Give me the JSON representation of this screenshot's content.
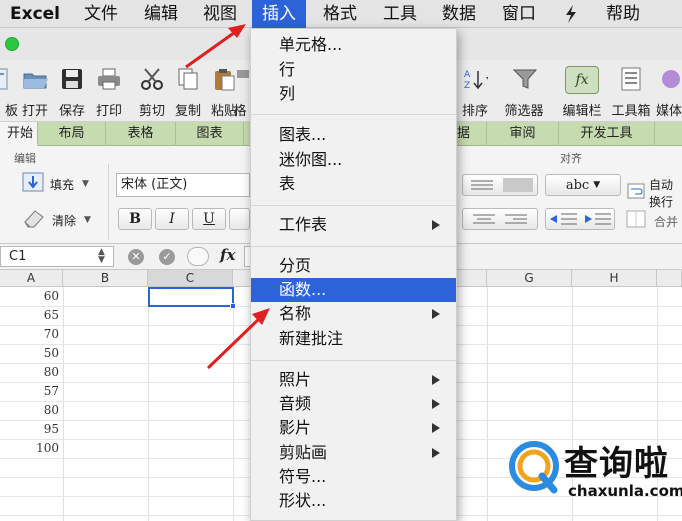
{
  "menubar": {
    "app": "Excel",
    "items": [
      "文件",
      "编辑",
      "视图",
      "插入",
      "格式",
      "工具",
      "数据",
      "窗口",
      "帮助"
    ]
  },
  "toolbar": {
    "buttons": [
      "板",
      "打开",
      "保存",
      "打印",
      "剪切",
      "复制",
      "粘贴",
      "格",
      "排序",
      "筛选器",
      "编辑栏",
      "工具箱",
      "媒体"
    ]
  },
  "ribbon_tabs": [
    "开始",
    "布局",
    "表格",
    "图表",
    "据",
    "审阅",
    "开发工具"
  ],
  "ribbon": {
    "edit_group": "编辑",
    "fill": "填充",
    "clear": "清除",
    "font_name": "宋体 (正文)",
    "bold": "B",
    "italic": "I",
    "underline": "U",
    "align_group": "对齐",
    "abc": "abc",
    "wrap": "自动换行",
    "merge": "合并"
  },
  "formula_bar": {
    "name_box": "C1",
    "fx": "fx"
  },
  "grid": {
    "columns": [
      "A",
      "B",
      "C",
      "G",
      "H"
    ],
    "column_a_values": [
      "60",
      "65",
      "70",
      "50",
      "80",
      "57",
      "80",
      "95",
      "100"
    ]
  },
  "insert_menu": {
    "group1": [
      "单元格...",
      "行",
      "列"
    ],
    "group2": [
      "图表...",
      "迷你图...",
      "表"
    ],
    "worksheet": "工作表",
    "group4": [
      "分页",
      "函数...",
      "名称",
      "新建批注"
    ],
    "group5": [
      "照片",
      "音频",
      "影片",
      "剪贴画",
      "符号...",
      "形状..."
    ],
    "highlighted": "函数..."
  },
  "watermark": {
    "brand": "查询啦",
    "url": "chaxunla.com"
  },
  "colors": {
    "highlight": "#2d63d8",
    "arrow": "#e02020",
    "ribbon_tab_bg": "#c7dbb0"
  }
}
